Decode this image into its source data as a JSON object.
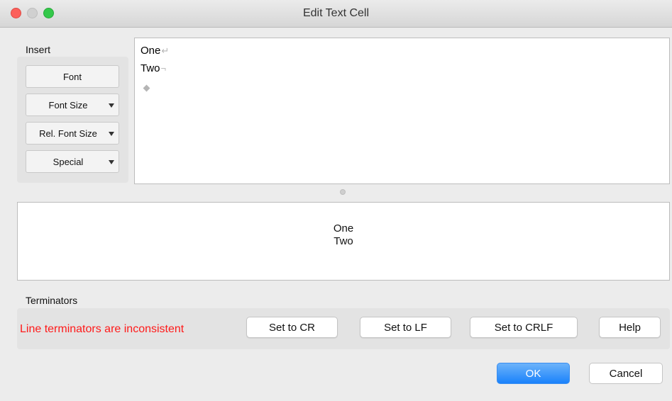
{
  "window": {
    "title": "Edit Text Cell"
  },
  "insert": {
    "label": "Insert",
    "buttons": [
      {
        "label": "Font",
        "has_menu": false
      },
      {
        "label": "Font Size",
        "has_menu": true
      },
      {
        "label": "Rel. Font Size",
        "has_menu": true
      },
      {
        "label": "Special",
        "has_menu": true
      }
    ]
  },
  "editor": {
    "lines": [
      {
        "text": "One",
        "terminator_mark": "↵"
      },
      {
        "text": "Two",
        "terminator_mark": "¬"
      }
    ],
    "end_marker_icon": "diamond-icon"
  },
  "preview": {
    "lines": [
      "One",
      "Two"
    ]
  },
  "terminators": {
    "label": "Terminators",
    "message": "Line terminators are inconsistent",
    "message_color": "#ff1a1a",
    "buttons": {
      "cr": "Set to CR",
      "lf": "Set to LF",
      "crlf": "Set to CRLF",
      "help": "Help"
    }
  },
  "footer": {
    "ok": "OK",
    "cancel": "Cancel",
    "accent": "#1a82fb"
  }
}
